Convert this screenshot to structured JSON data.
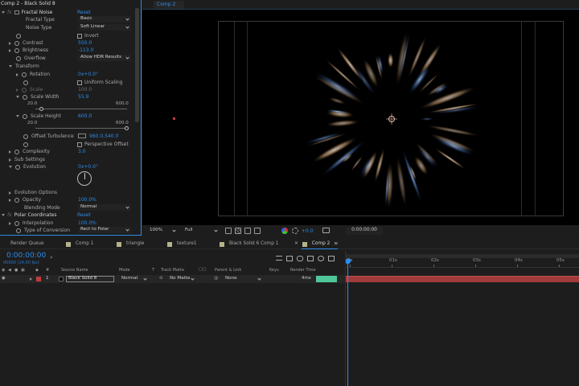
{
  "effects_panel": {
    "title": "Comp 2 - Black Solid 8",
    "effect_name": "Fractal Noise",
    "reset": "Reset",
    "fx": "fx",
    "props": {
      "fractal_type": {
        "label": "Fractal Type",
        "value": "Basic"
      },
      "noise_type": {
        "label": "Noise Type",
        "value": "Soft Linear"
      },
      "invert": {
        "label": "Invert"
      },
      "contrast": {
        "label": "Contrast",
        "value": "550.0"
      },
      "brightness": {
        "label": "Brightness",
        "value": "-113.0"
      },
      "overflow": {
        "label": "Overflow",
        "value": "Allow HDR Results"
      },
      "transform": {
        "label": "Transform"
      },
      "rotation": {
        "label": "Rotation",
        "value": "0x+0.0°"
      },
      "uniform_scaling": {
        "label": "Uniform Scaling"
      },
      "scale": {
        "label": "Scale",
        "value": "100.0"
      },
      "scale_width": {
        "label": "Scale Width",
        "value": "55.9",
        "min": "20.0",
        "max": "600.0",
        "level": 0.07
      },
      "scale_height": {
        "label": "Scale Height",
        "value": "600.0",
        "min": "20.0",
        "max": "600.0",
        "level": 1.0
      },
      "offset_turbulence": {
        "label": "Offset Turbulence",
        "value": "960.0,540.0"
      },
      "perspective_offset": {
        "label": "Perspective Offset"
      },
      "complexity": {
        "label": "Complexity",
        "value": "3.0"
      },
      "sub_settings": {
        "label": "Sub Settings"
      },
      "evolution": {
        "label": "Evolution",
        "value": "0x+0.0°"
      },
      "evolution_options": {
        "label": "Evolution Options"
      },
      "opacity": {
        "label": "Opacity",
        "value": "100.0%"
      },
      "blending_mode": {
        "label": "Blending Mode",
        "value": "Normal"
      }
    },
    "polar": {
      "name": "Polar Coordinates",
      "reset": "Reset",
      "interpolation": {
        "label": "Interpolation",
        "value": "100.0%"
      },
      "type_of_conversion": {
        "label": "Type of Conversion",
        "value": "Rect to Polar"
      }
    }
  },
  "composition": {
    "tab": "Comp 2",
    "zoom": "100%",
    "resolution": "Full",
    "exposure": "+0.0",
    "timecode": "0:00:00:00"
  },
  "timeline": {
    "tabs": [
      "Render Queue",
      "Comp 1",
      "triangle",
      "texture1",
      "Black Solid 6 Comp 1",
      "Comp 2"
    ],
    "tab_colors": [
      "",
      "#b6b38b",
      "#b6b38b",
      "#b6b38b",
      "#b6b38b",
      "#b6b38b"
    ],
    "timecode": "0:00:00:00",
    "fps": "00000 (24.00 fps)",
    "search_placeholder": "",
    "columns": {
      "hash": "#",
      "source_name": "Source Name",
      "mode": "Mode",
      "t": "T",
      "track_matte": "Track Matte",
      "parent_link": "Parent & Link",
      "keys": "Keys",
      "render_time": "Render Time"
    },
    "layer": {
      "number": "1",
      "name": "Black Solid 8",
      "mode": "Normal",
      "track_matte": "No Matte",
      "parent": "None",
      "render_time": "4ms",
      "label_color": "#c23b3b"
    },
    "ruler": [
      "0s",
      "01s",
      "02s",
      "03s",
      "04s",
      "05s"
    ]
  }
}
